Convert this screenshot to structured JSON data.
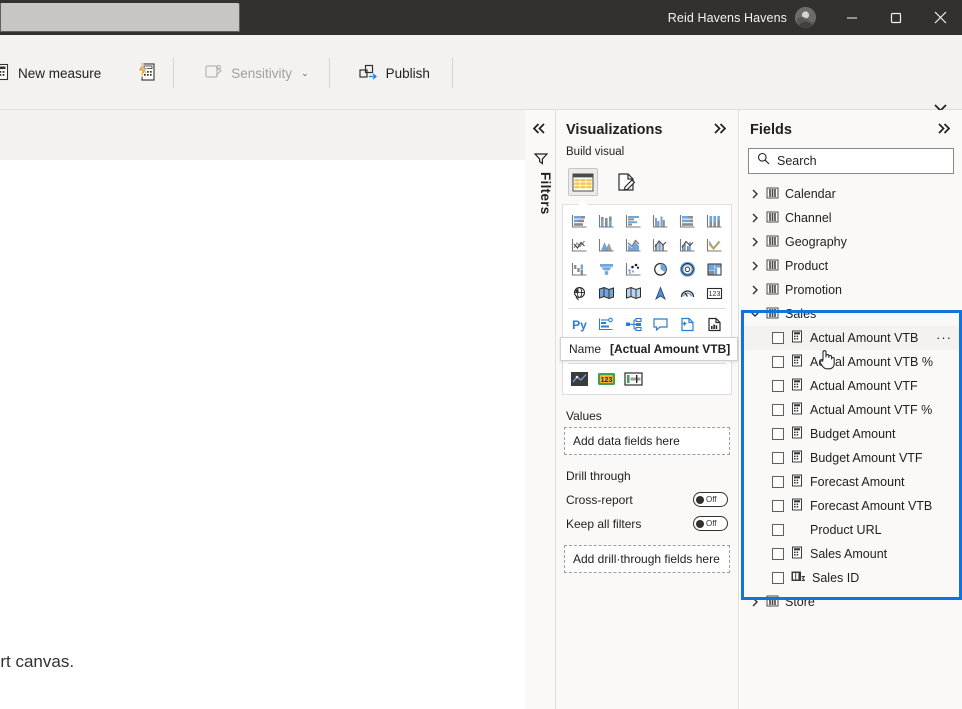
{
  "titlebar": {
    "account_name": "Reid Havens Havens",
    "avatar_name": "user-avatar",
    "minimize_label": "─",
    "restore_label": "❐",
    "close_label": "✕"
  },
  "ribbon": {
    "items": [
      {
        "label": "New measure",
        "icon": "new-measure-icon",
        "disabled": false
      },
      {
        "label": "",
        "icon": "quick-measure-icon",
        "disabled": false
      },
      {
        "label": "Sensitivity",
        "icon": "sensitivity-icon",
        "disabled": true,
        "caret": "⌄"
      },
      {
        "label": "Publish",
        "icon": "publish-icon",
        "disabled": false
      }
    ],
    "collapse_icon": "chevron-down-icon"
  },
  "canvas": {
    "text": "eport canvas."
  },
  "filters_rail": {
    "collapse_icon": "double-chevron-left-icon",
    "funnel_icon": "filter-funnel-icon",
    "label": "Filters"
  },
  "visualizations": {
    "title": "Visualizations",
    "expand_icon": "double-chevron-right-icon",
    "build_visual_label": "Build visual",
    "tabs": [
      {
        "name": "build-visual-tab",
        "icon": "table-grid-icon",
        "selected": true
      },
      {
        "name": "format-visual-tab",
        "icon": "format-paint-icon",
        "selected": false
      }
    ],
    "icon_grid": [
      "stacked-bar-chart-icon",
      "stacked-column-chart-icon",
      "clustered-bar-chart-icon",
      "clustered-column-chart-icon",
      "hundred-percent-stacked-bar-icon",
      "hundred-percent-stacked-column-icon",
      "line-chart-icon",
      "area-chart-icon",
      "stacked-area-chart-icon",
      "line-stacked-column-icon",
      "line-clustered-column-icon",
      "ribbon-chart-icon",
      "waterfall-chart-icon",
      "funnel-chart-icon",
      "scatter-chart-icon",
      "pie-chart-icon",
      "donut-chart-icon",
      "treemap-icon",
      "map-icon",
      "filled-map-icon",
      "shape-map-icon",
      "azure-map-icon",
      "gauge-chart-icon",
      "card-icon",
      "python-visual-icon",
      "key-influencers-icon",
      "decomposition-tree-icon",
      "qa-visual-icon",
      "smart-narrative-icon",
      "paginated-report-icon",
      "arcgis-map-icon",
      "power-apps-icon",
      "power-automate-icon",
      "more-options-icon",
      "sparkline-visual-icon",
      "number-card-visual-icon",
      "bullet-chart-visual-icon"
    ],
    "tooltip": {
      "label": "Name",
      "value": "[Actual Amount VTB]"
    },
    "values_label": "Values",
    "values_placeholder": "Add data fields here",
    "drill_through_label": "Drill through",
    "cross_report_label": "Cross-report",
    "cross_report_state": "Off",
    "keep_all_filters_label": "Keep all filters",
    "keep_all_filters_state": "Off",
    "drill_placeholder": "Add drill·through fields here"
  },
  "fields": {
    "title": "Fields",
    "expand_icon": "double-chevron-right-icon",
    "search_placeholder": "Search",
    "search_icon": "search-icon",
    "tables": [
      {
        "name": "Calendar",
        "expanded": false,
        "icon": "table-icon"
      },
      {
        "name": "Channel",
        "expanded": false,
        "icon": "table-icon"
      },
      {
        "name": "Geography",
        "expanded": false,
        "icon": "table-icon"
      },
      {
        "name": "Product",
        "expanded": false,
        "icon": "table-icon"
      },
      {
        "name": "Promotion",
        "expanded": false,
        "icon": "table-icon"
      },
      {
        "name": "Sales",
        "expanded": true,
        "icon": "table-icon"
      },
      {
        "name": "Store",
        "expanded": false,
        "icon": "table-icon"
      }
    ],
    "sales_fields": [
      {
        "name": "Actual Amount VTB",
        "icon": "measure-icon",
        "checked": false,
        "hovered": true,
        "has_menu": true
      },
      {
        "name": "Actual Amount VTB %",
        "icon": "measure-icon",
        "checked": false,
        "hovered": false,
        "has_menu": false
      },
      {
        "name": "Actual Amount VTF",
        "icon": "measure-icon",
        "checked": false,
        "hovered": false,
        "has_menu": false
      },
      {
        "name": "Actual Amount VTF %",
        "icon": "measure-icon",
        "checked": false,
        "hovered": false,
        "has_menu": false
      },
      {
        "name": "Budget Amount",
        "icon": "measure-icon",
        "checked": false,
        "hovered": false,
        "has_menu": false
      },
      {
        "name": "Budget Amount VTF",
        "icon": "measure-icon",
        "checked": false,
        "hovered": false,
        "has_menu": false
      },
      {
        "name": "Forecast Amount",
        "icon": "measure-icon",
        "checked": false,
        "hovered": false,
        "has_menu": false
      },
      {
        "name": "Forecast Amount VTB",
        "icon": "measure-icon",
        "checked": false,
        "hovered": false,
        "has_menu": false
      },
      {
        "name": "Product URL",
        "icon": "none",
        "checked": false,
        "hovered": false,
        "has_menu": false
      },
      {
        "name": "Sales Amount",
        "icon": "measure-icon",
        "checked": false,
        "hovered": false,
        "has_menu": false
      },
      {
        "name": "Sales ID",
        "icon": "summarized-column-icon",
        "checked": false,
        "hovered": false,
        "has_menu": false
      }
    ],
    "highlight_color": "#1273de"
  },
  "colors": {
    "titlebar_bg": "#323130",
    "ribbon_bg": "#f3f2f1",
    "pane_bg": "#faf9f8",
    "accent": "#1273de",
    "viz_icon_blue": "#71a5dc",
    "viz_icon_gray": "#6e6e6e",
    "text": "#201f1e"
  }
}
